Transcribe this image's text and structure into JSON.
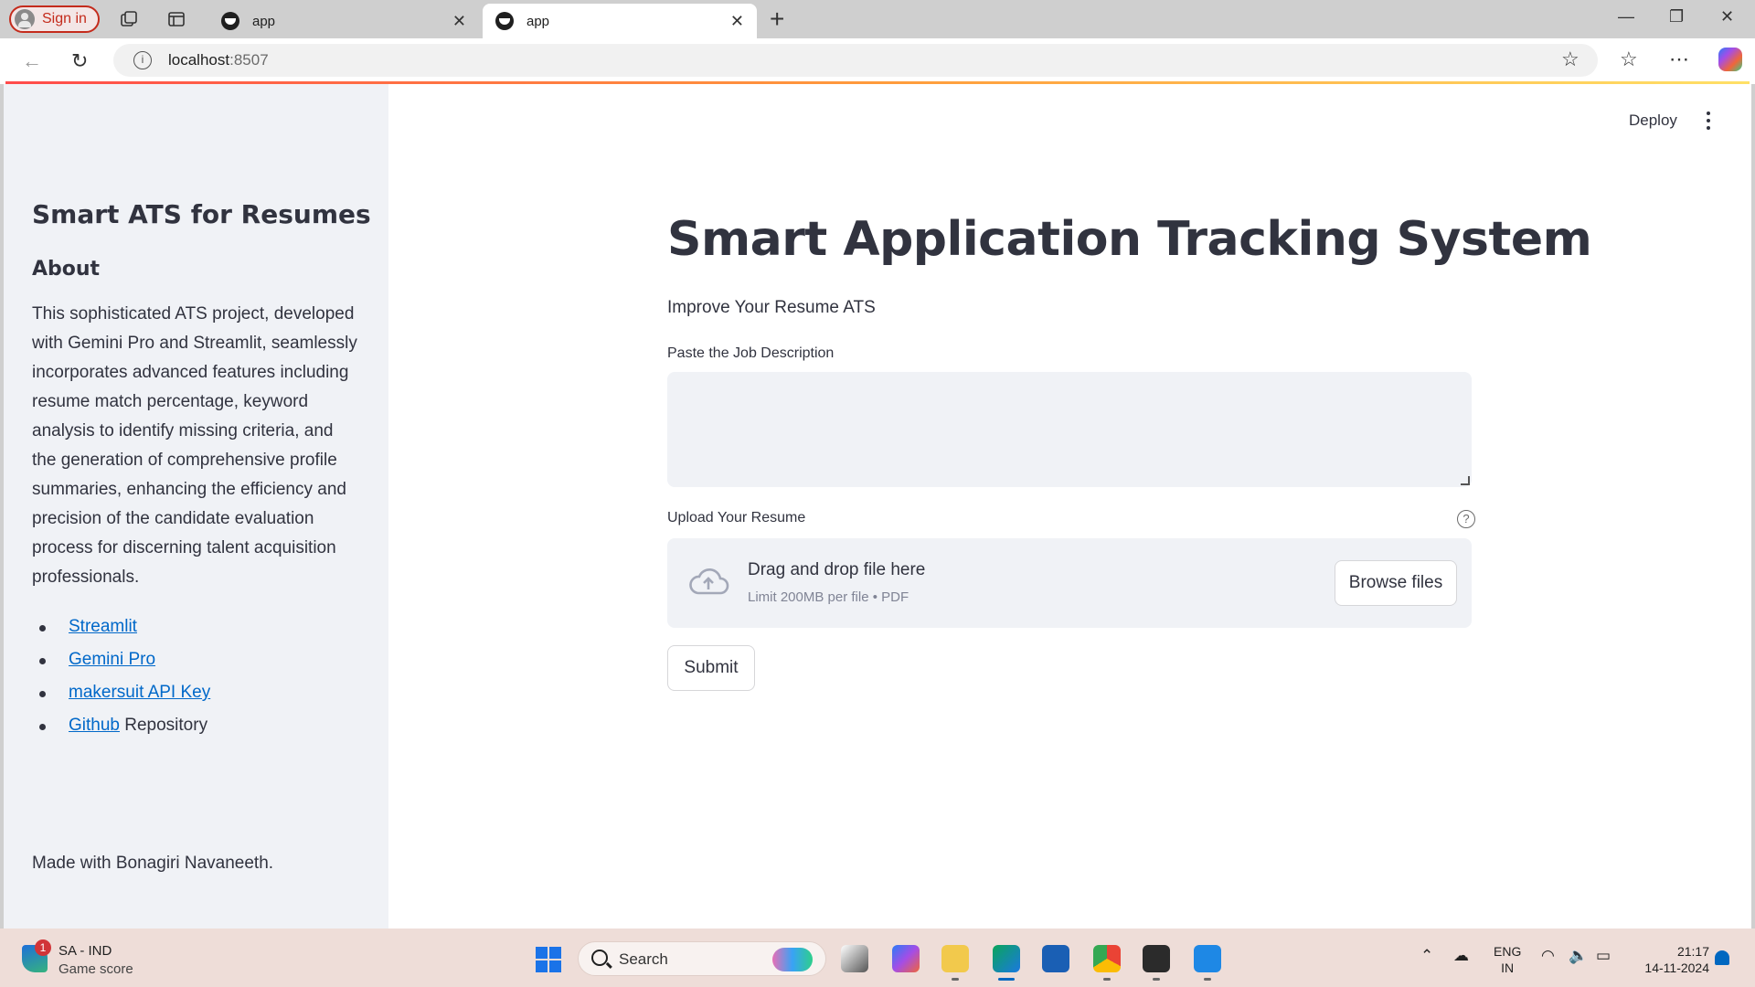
{
  "browser": {
    "signin_label": "Sign in",
    "tabs": [
      {
        "title": "app",
        "active": false
      },
      {
        "title": "app",
        "active": true
      }
    ],
    "url_host": "localhost",
    "url_port": ":8507"
  },
  "header": {
    "deploy_label": "Deploy"
  },
  "sidebar": {
    "title": "Smart ATS for Resumes",
    "about_heading": "About",
    "description": "This sophisticated ATS project, developed with Gemini Pro and Streamlit, seamlessly incorporates advanced features including resume match percentage, keyword analysis to identify missing criteria, and the generation of comprehensive profile summaries, enhancing the efficiency and precision of the candidate evaluation process for discerning talent acquisition professionals.",
    "links": [
      {
        "link_text": "Streamlit",
        "suffix": ""
      },
      {
        "link_text": "Gemini Pro",
        "suffix": ""
      },
      {
        "link_text": "makersuit API Key",
        "suffix": ""
      },
      {
        "link_text": "Github",
        "suffix": " Repository"
      }
    ],
    "footer": "Made with Bonagiri Navaneeth."
  },
  "main": {
    "title": "Smart Application Tracking System",
    "subtitle": "Improve Your Resume ATS",
    "jd_label": "Paste the Job Description",
    "jd_value": "",
    "upload_label": "Upload Your Resume",
    "help_glyph": "?",
    "dropzone_text": "Drag and drop file here",
    "dropzone_limit": "Limit 200MB per file • PDF",
    "browse_label": "Browse files",
    "submit_label": "Submit"
  },
  "taskbar": {
    "score_badge": "1",
    "score_title": "SA - IND",
    "score_sub": "Game score",
    "search_placeholder": "Search",
    "lang_line1": "ENG",
    "lang_line2": "IN",
    "time": "21:17",
    "date": "14-11-2024"
  },
  "colors": {
    "accent_link": "#0068c9",
    "sidebar_bg": "#f0f2f6",
    "text": "#31333f",
    "signin_red": "#c42b1c"
  },
  "icons": [
    "user-avatar-icon",
    "collections-icon",
    "tab-actions-icon",
    "streamlit-favicon-icon",
    "close-icon",
    "plus-icon",
    "minimize-icon",
    "restore-icon",
    "back-icon",
    "refresh-icon",
    "info-icon",
    "star-icon",
    "favorites-icon",
    "more-icon",
    "copilot-icon",
    "kebab-icon",
    "help-icon",
    "cloud-upload-icon",
    "windows-start-icon",
    "search-icon",
    "wifi-icon",
    "volume-icon",
    "battery-icon",
    "bell-icon"
  ]
}
